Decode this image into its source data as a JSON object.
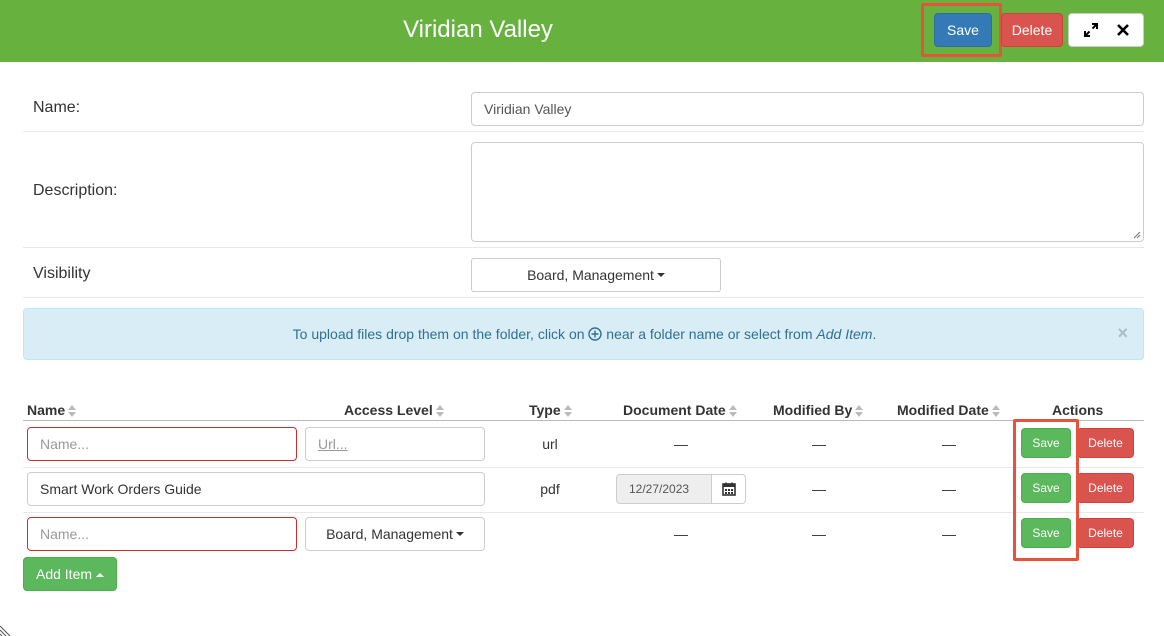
{
  "header": {
    "title": "Viridian Valley",
    "save_label": "Save",
    "delete_label": "Delete"
  },
  "form": {
    "name_label": "Name:",
    "name_value": "Viridian Valley",
    "description_label": "Description:",
    "description_value": "",
    "visibility_label": "Visibility",
    "visibility_value": "Board, Management"
  },
  "alert": {
    "text_before": "To upload files drop them on the folder, click on",
    "text_after": "near a folder name or select from",
    "text_link": "Add Item",
    "text_end": ".",
    "close": "×"
  },
  "table": {
    "columns": [
      "Name",
      "Access Level",
      "Type",
      "Document Date",
      "Modified By",
      "Modified Date",
      "Actions"
    ],
    "rows": [
      {
        "name_placeholder": "Name...",
        "url_placeholder": "Url...",
        "type": "url",
        "document_date": "—",
        "modified_by": "—",
        "modified_date": "—",
        "save_label": "Save",
        "delete_label": "Delete"
      },
      {
        "name_value": "Smart Work Orders Guide",
        "type": "pdf",
        "document_date": "12/27/2023",
        "modified_by": "—",
        "modified_date": "—",
        "save_label": "Save",
        "delete_label": "Delete"
      },
      {
        "name_placeholder": "Name...",
        "access_level": "Board, Management",
        "type": "",
        "document_date": "—",
        "modified_by": "—",
        "modified_date": "—",
        "save_label": "Save",
        "delete_label": "Delete"
      }
    ]
  },
  "add_item_label": "Add Item",
  "colors": {
    "header_green": "#67b13f",
    "primary_blue": "#337ab7",
    "danger_red": "#d9534f",
    "success_green": "#5cb85c",
    "highlight": "#e5533d",
    "alert_bg": "#d9edf7"
  },
  "icons": [
    "expand-icon",
    "close-icon",
    "add-circle-icon",
    "calendar-icon",
    "sort-icon",
    "caret-down-icon",
    "caret-up-icon",
    "resize-grip-icon"
  ]
}
